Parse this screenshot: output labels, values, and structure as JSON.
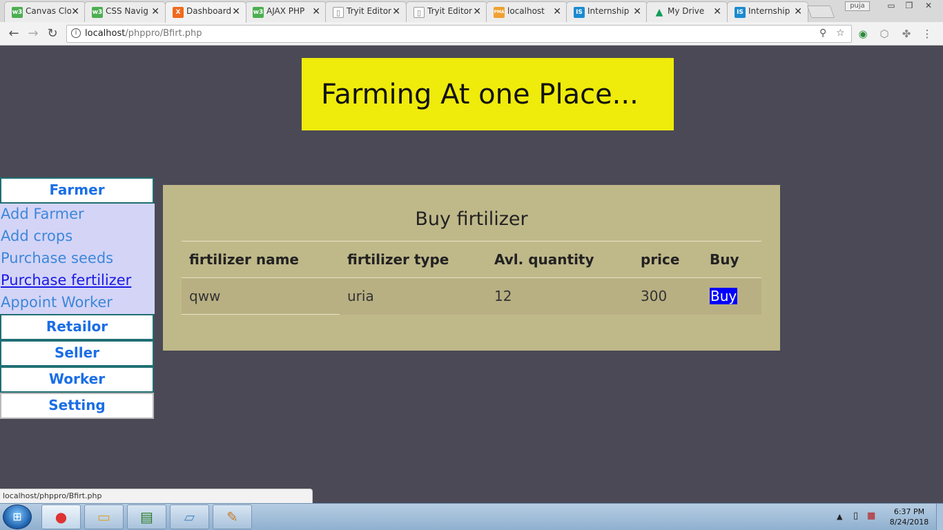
{
  "browser": {
    "tabs": [
      {
        "title": "Canvas Clo",
        "favicon": "w3-icon",
        "color": "#4caf50",
        "glyph": "w3"
      },
      {
        "title": "CSS Navig",
        "favicon": "w3-icon",
        "color": "#4caf50",
        "glyph": "w3"
      },
      {
        "title": "Dashboard",
        "favicon": "xampp-icon",
        "color": "#f06a1e",
        "glyph": "X",
        "active": true
      },
      {
        "title": "AJAX PHP",
        "favicon": "w3-icon",
        "color": "#4caf50",
        "glyph": "w3"
      },
      {
        "title": "Tryit Editor",
        "favicon": "page-icon",
        "color": "#ffffff",
        "glyph": "▯"
      },
      {
        "title": "Tryit Editor",
        "favicon": "page-icon",
        "color": "#ffffff",
        "glyph": "▯"
      },
      {
        "title": "localhost",
        "favicon": "phpmyadmin-icon",
        "color": "#f0a030",
        "glyph": "PMA"
      },
      {
        "title": "Internship",
        "favicon": "internshala-icon",
        "color": "#1b8bd1",
        "glyph": "IS"
      },
      {
        "title": "My Drive",
        "favicon": "google-drive-icon",
        "color": "#f4b400",
        "glyph": "▲"
      },
      {
        "title": "Internship",
        "favicon": "internshala-icon",
        "color": "#1b8bd1",
        "glyph": "IS"
      }
    ],
    "profile_name": "puja",
    "url_host": "localhost",
    "url_path": "/phppro/Bfirt.php",
    "status_url": "localhost/phppro/Bfirt.php"
  },
  "page": {
    "header_title": "Farming At one Place...",
    "sidebar": {
      "farmer": "Farmer",
      "farmer_links": [
        "Add Farmer",
        "Add crops",
        "Purchase seeds",
        "Purchase fertilizer",
        "Appoint Worker"
      ],
      "retailor": "Retailor",
      "seller": "Seller",
      "worker": "Worker",
      "setting": "Setting"
    },
    "panel": {
      "title": "Buy firtilizer",
      "columns": [
        "firtilizer name",
        "firtilizer type",
        "Avl. quantity",
        "price",
        "Buy"
      ],
      "rows": [
        {
          "name": "qww",
          "type": "uria",
          "quantity": "12",
          "price": "300",
          "buy_label": "Buy"
        }
      ]
    },
    "colors": {
      "background": "#4a4955",
      "header": "#efeb0b",
      "panel": "#bfb889",
      "submenu": "#d4d4f7",
      "link": "#3d87d9",
      "buy_button": "#0000ff"
    }
  },
  "taskbar": {
    "time": "6:37 PM",
    "date": "8/24/2018"
  }
}
